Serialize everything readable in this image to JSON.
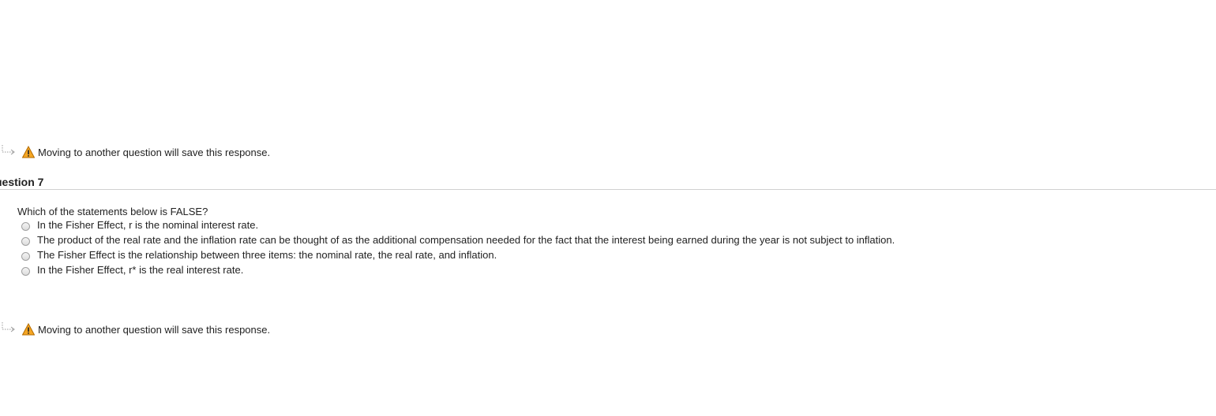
{
  "notice_top": {
    "arrow_icon": "arrow-return-icon",
    "warning_icon": "warning-icon",
    "text": "Moving to another question will save this response."
  },
  "question": {
    "header": "uestion 7",
    "prompt": "Which of the statements below is FALSE?",
    "options": [
      "In the Fisher Effect, r is the nominal interest rate.",
      "The product of the real rate and the inflation rate can be thought of as the additional compensation needed for the fact that the interest being earned during the year is not subject to inflation.",
      "The Fisher Effect is the relationship between three items: the nominal rate, the real rate, and inflation.",
      "In the Fisher Effect, r* is the real interest rate."
    ]
  },
  "notice_bottom": {
    "arrow_icon": "arrow-return-icon",
    "warning_icon": "warning-icon",
    "text": "Moving to another question will save this response."
  },
  "colors": {
    "warning_fill": "#f5a623",
    "divider": "#d0d0d0"
  }
}
